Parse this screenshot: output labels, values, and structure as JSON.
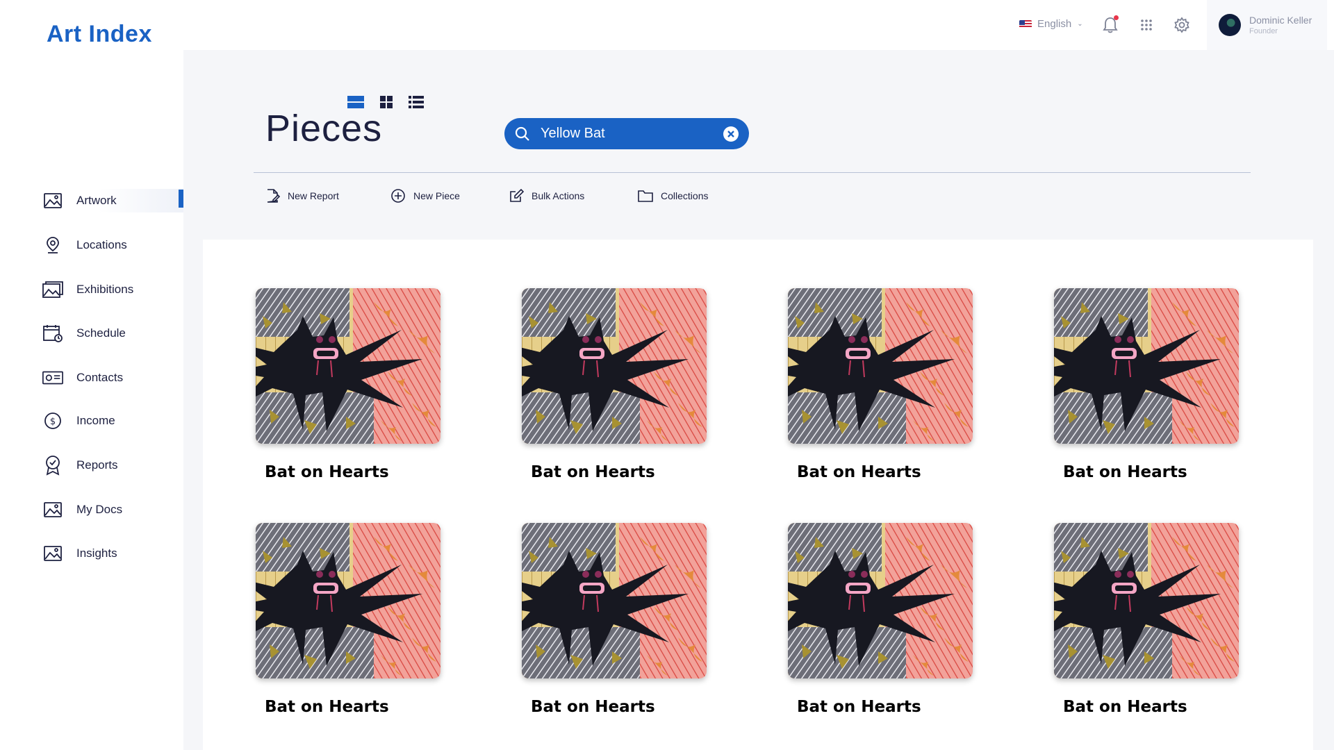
{
  "app": {
    "logo": "Art Index"
  },
  "header": {
    "language": "English",
    "user": {
      "name": "Dominic Keller",
      "role": "Founder"
    }
  },
  "sidebar": {
    "items": [
      {
        "label": "Artwork",
        "icon": "image-icon",
        "active": true
      },
      {
        "label": "Locations",
        "icon": "map-pin-icon"
      },
      {
        "label": "Exhibitions",
        "icon": "gallery-icon"
      },
      {
        "label": "Schedule",
        "icon": "calendar-icon"
      },
      {
        "label": "Contacts",
        "icon": "contact-card-icon"
      },
      {
        "label": "Income",
        "icon": "dollar-icon"
      },
      {
        "label": "Reports",
        "icon": "badge-icon"
      },
      {
        "label": "My Docs",
        "icon": "image-icon"
      },
      {
        "label": "Insights",
        "icon": "image-icon"
      }
    ]
  },
  "main": {
    "title": "Pieces",
    "search": {
      "value": "Yellow Bat"
    },
    "actions": [
      {
        "label": "New Report",
        "icon": "file-edit-icon"
      },
      {
        "label": "New Piece",
        "icon": "plus-circle-icon"
      },
      {
        "label": "Bulk Actions",
        "icon": "edit-icon"
      },
      {
        "label": "Collections",
        "icon": "folder-icon"
      }
    ],
    "pieces": [
      {
        "title": "Bat on Hearts"
      },
      {
        "title": "Bat on Hearts"
      },
      {
        "title": "Bat on Hearts"
      },
      {
        "title": "Bat on Hearts"
      },
      {
        "title": "Bat on Hearts"
      },
      {
        "title": "Bat on Hearts"
      },
      {
        "title": "Bat on Hearts"
      },
      {
        "title": "Bat on Hearts"
      }
    ]
  },
  "colors": {
    "accent": "#1a62c4",
    "text": "#1d2040",
    "notification": "#e8364b"
  }
}
